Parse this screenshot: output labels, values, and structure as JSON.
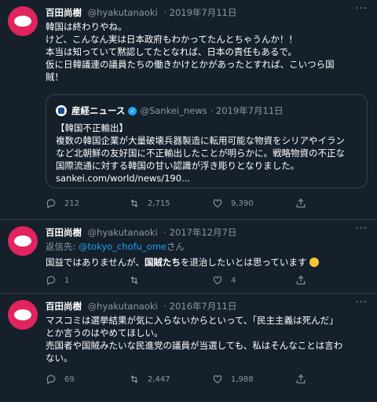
{
  "tweets": [
    {
      "name": "百田尚樹",
      "handle": "@hyakutanaoki",
      "date": "· 2019年7月11日",
      "lines": [
        "韓国は終わりやね。",
        "けど、こんなん実は日本政府もわかってたんとちゃうんか！！",
        "本当は知っていて黙認してたとなれば、日本の責任もあるで。",
        "仮に日韓議連の議員たちの働きかけとかがあったとすれば、こいつら国",
        "賊！"
      ],
      "quote": {
        "name": "産経ニュース",
        "handle": "@Sankei_news",
        "date": "· 2019年7月11日",
        "lines": [
          "【韓国不正輸出】",
          "複数の韓国企業が大量破壊兵器製造に転用可能な物資をシリアやイラン",
          "など北朝鮮の友好国に不正輸出したことが明らかに。戦略物資の不正な",
          "国際流通に対する韓国の甘い認識が浮き彫りとなりました。",
          "sankei.com/world/news/190..."
        ]
      },
      "counts": {
        "replies": "212",
        "retweets": "2,715",
        "likes": "9,390"
      }
    },
    {
      "name": "百田尚樹",
      "handle": "@hyakutanaoki",
      "date": "· 2017年12月7日",
      "reply_prefix": "返信先: ",
      "reply_link": "@tokyo_chofu_ome",
      "reply_suffix": "さん",
      "text_a": "国益ではありませんが、",
      "text_b": "国賊たち",
      "text_c": "を退治したいとは思っています",
      "counts": {
        "replies": "1",
        "retweets": "",
        "likes": "4"
      }
    },
    {
      "name": "百田尚樹",
      "handle": "@hyakutanaoki",
      "date": "· 2016年7月11日",
      "lines": [
        "マスコミは選挙結果が気に入らないからといって、「民主主義は死んだ」",
        "とか言うのはやめてほしい。",
        "売国者や国賊みたいな民進党の議員が当選しても、私はそんなことは言わ",
        "ない。"
      ],
      "counts": {
        "replies": "69",
        "retweets": "2,447",
        "likes": "1,988"
      }
    }
  ]
}
